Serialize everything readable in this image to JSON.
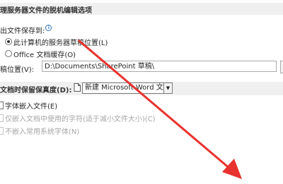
{
  "section1": {
    "title": "理服务器文件的脱机编辑选项"
  },
  "save_to": {
    "label": "出文件保存到:",
    "option_server_drafts": "此计算机的服务器草稿位置(L)",
    "option_office_cache": "Office 文档缓存(O)",
    "selected": "option_server_drafts"
  },
  "drafts_location": {
    "label": "稿位置(V):",
    "value": "D:\\Documents\\SharePoint 草稿\\"
  },
  "fidelity": {
    "label": "文档时保留保真度(D):",
    "selected_value": "新建 Microsoft Word 文档"
  },
  "embed_fonts": {
    "label": "字体嵌入文件(E)",
    "opt_embed_used_only": "仅嵌入文档中使用的字符(适于减小文件大小)(C)",
    "opt_no_common_fonts": "不嵌入常用系统字体(N)"
  },
  "arrow_color": "#e8322e"
}
